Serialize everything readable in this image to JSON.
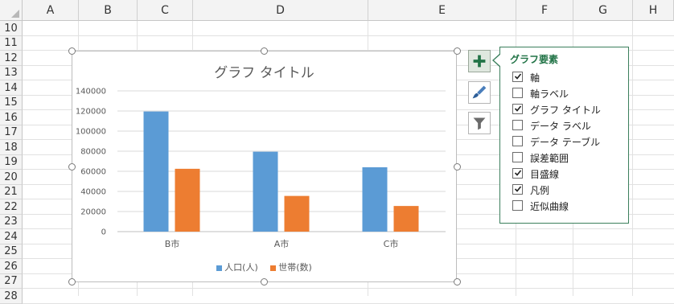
{
  "sheet": {
    "columns": [
      "A",
      "B",
      "C",
      "D",
      "E",
      "F",
      "G",
      "H"
    ],
    "rows": [
      "10",
      "11",
      "12",
      "13",
      "14",
      "15",
      "16",
      "17",
      "18",
      "19",
      "20",
      "21",
      "22",
      "23",
      "24",
      "25",
      "26",
      "27",
      "28"
    ]
  },
  "chart": {
    "title": "グラフ タイトル",
    "legend": [
      "人口(人)",
      "世帯(数)"
    ]
  },
  "chart_data": {
    "type": "bar",
    "title": "グラフ タイトル",
    "categories": [
      "B市",
      "A市",
      "C市"
    ],
    "series": [
      {
        "name": "人口(人)",
        "values": [
          119500,
          79500,
          64000
        ],
        "color": "#5b9bd5"
      },
      {
        "name": "世帯(数)",
        "values": [
          62500,
          35500,
          25500
        ],
        "color": "#ed7d31"
      }
    ],
    "ylim": [
      0,
      140000
    ],
    "yticks": [
      "0",
      "20000",
      "40000",
      "60000",
      "80000",
      "100000",
      "120000",
      "140000"
    ],
    "grid": true,
    "legend_position": "bottom"
  },
  "pane": {
    "title": "グラフ要素",
    "options": [
      {
        "label": "軸",
        "checked": true
      },
      {
        "label": "軸ラベル",
        "checked": false
      },
      {
        "label": "グラフ タイトル",
        "checked": true
      },
      {
        "label": "データ ラベル",
        "checked": false
      },
      {
        "label": "データ テーブル",
        "checked": false
      },
      {
        "label": "誤差範囲",
        "checked": false
      },
      {
        "label": "目盛線",
        "checked": true
      },
      {
        "label": "凡例",
        "checked": true
      },
      {
        "label": "近似曲線",
        "checked": false
      }
    ]
  },
  "side_buttons": {
    "elements_icon": "plus-icon",
    "style_icon": "paintbrush-icon",
    "filter_icon": "filter-icon",
    "accent": "#217346"
  }
}
